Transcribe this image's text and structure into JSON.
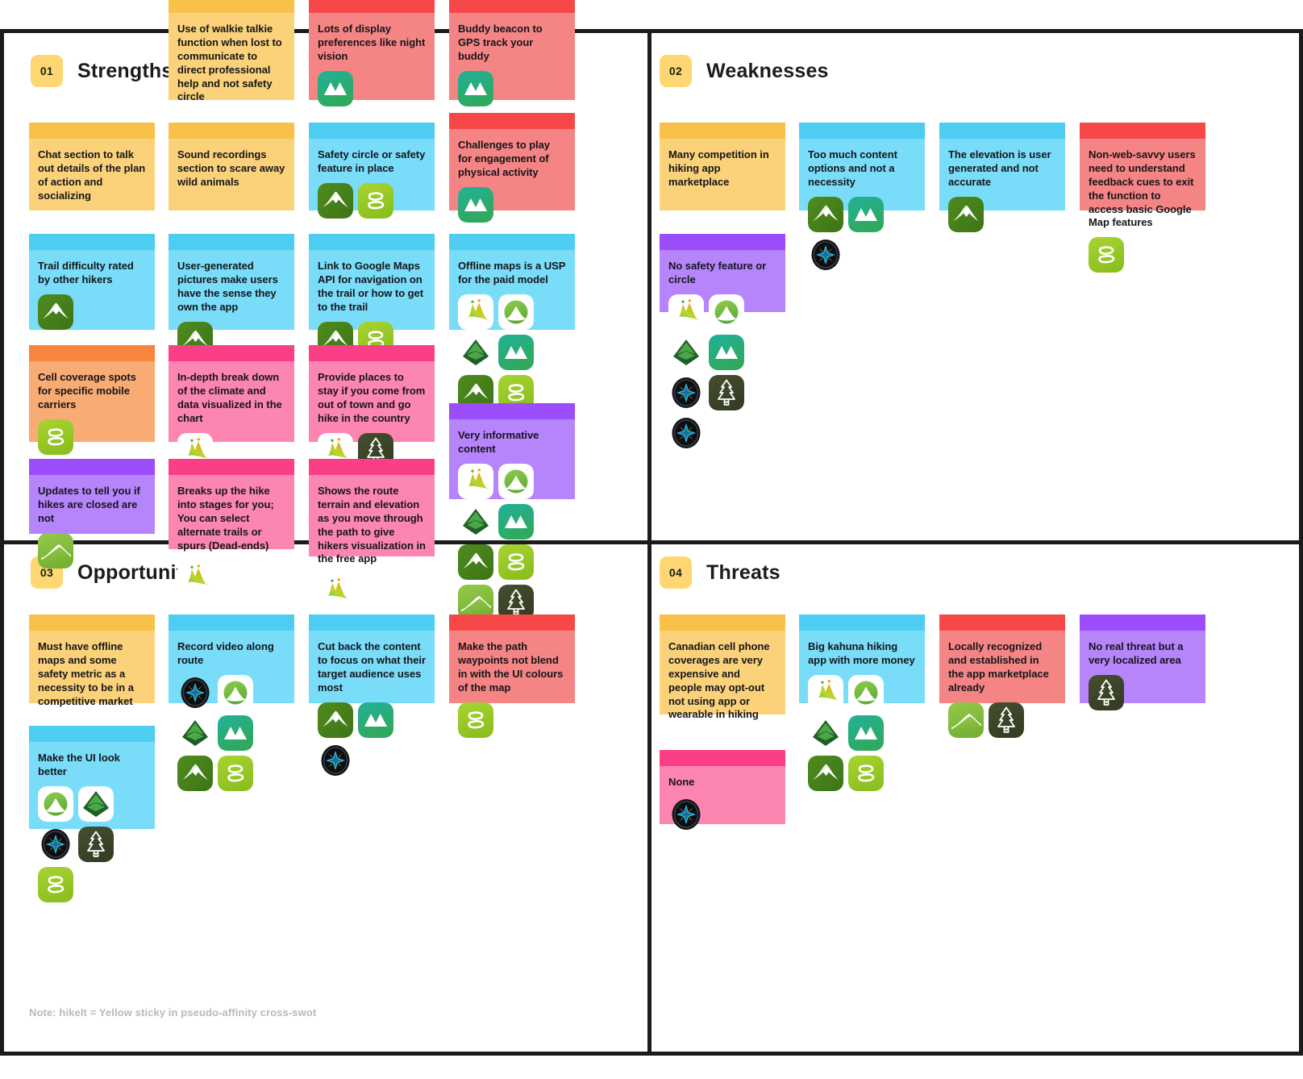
{
  "board": {
    "footer_note": "Note: hikeIt = Yellow sticky in pseudo-affinity cross-swot",
    "accent_badge_color": "#ffd772"
  },
  "quadrants": [
    {
      "num": "01",
      "title": "Strengths"
    },
    {
      "num": "02",
      "title": "Weaknesses"
    },
    {
      "num": "03",
      "title": "Opportunities"
    },
    {
      "num": "04",
      "title": "Threats"
    }
  ],
  "icon_legend": {
    "alltrails": "alltrails-icon",
    "gaia": "gaia-gps-icon",
    "komoot": "komoot-icon",
    "hikingproject": "hiking-project-icon",
    "peakvisor": "peakvisor-icon",
    "outdooractive": "outdooractive-icon",
    "viewranger": "viewranger-compass-icon",
    "pinetree": "pine-tree-icon"
  },
  "notes": {
    "s1": {
      "text": "Use of walkie talkie function when lost to communicate to direct professional help and not safety circle",
      "color": "yellow",
      "icons": []
    },
    "s2": {
      "text": "Lots of display preferences like night vision",
      "color": "red",
      "icons": [
        "komoot"
      ]
    },
    "s3": {
      "text": "Buddy beacon to GPS track your buddy",
      "color": "red",
      "icons": [
        "komoot"
      ]
    },
    "s4": {
      "text": "Chat section to talk out details of the plan of action and socializing",
      "color": "yellow",
      "icons": []
    },
    "s5": {
      "text": "Sound recordings section to scare away wild animals",
      "color": "yellow",
      "icons": []
    },
    "s6": {
      "text": "Safety circle or safety feature in place",
      "color": "blue",
      "icons": [
        "alltrails",
        "outdooractive"
      ]
    },
    "s7": {
      "text": "Challenges to play for engagement of physical activity",
      "color": "red",
      "icons": [
        "komoot"
      ]
    },
    "s8": {
      "text": "Trail difficulty rated by other hikers",
      "color": "blue",
      "icons": [
        "alltrails"
      ]
    },
    "s9": {
      "text": "User-generated pictures make users have the sense they own the app",
      "color": "blue",
      "icons": [
        "alltrails"
      ]
    },
    "s10": {
      "text": "Link to Google Maps API for navigation on the trail or how to get to the trail",
      "color": "blue",
      "icons": [
        "alltrails",
        "outdooractive"
      ]
    },
    "s11": {
      "text": "Offline maps is a USP for the paid model",
      "color": "blue",
      "icons": [
        "peakvisor",
        "gaia",
        "hikingproject",
        "komoot",
        "alltrails",
        "outdooractive",
        "viewranger",
        "pinetree"
      ]
    },
    "s12": {
      "text": "Cell coverage spots for specific mobile carriers",
      "color": "orange",
      "icons": [
        "outdooractive"
      ]
    },
    "s13": {
      "text": "In-depth break down of the climate and data visualized in the chart",
      "color": "pink",
      "icons": [
        "peakvisor"
      ]
    },
    "s14": {
      "text": "Provide places to stay if you come from out of town and go hike in the country",
      "color": "pink",
      "icons": [
        "peakvisor",
        "pinetree"
      ]
    },
    "s15": {
      "text": "Very informative content",
      "color": "purple",
      "icons": [
        "peakvisor",
        "gaia",
        "hikingproject",
        "komoot",
        "alltrails",
        "outdooractive",
        "viewranger",
        "pinetree"
      ]
    },
    "s16": {
      "text": "Updates to tell you if hikes are closed are not",
      "color": "purple",
      "icons": [
        "viewranger"
      ]
    },
    "s17": {
      "text": "Breaks up the hike into stages for you; You can select alternate trails or spurs (Dead-ends)",
      "color": "pink",
      "icons": [
        "peakvisor"
      ]
    },
    "s18": {
      "text": "Shows the route terrain and elevation as you move through the path to give hikers visualization in the free app",
      "color": "pink",
      "icons": [
        "peakvisor"
      ]
    },
    "w1": {
      "text": "Many competition in hiking app marketplace",
      "color": "yellow",
      "icons": []
    },
    "w2": {
      "text": "Too much content options and not a necessity",
      "color": "blue",
      "icons": [
        "alltrails",
        "komoot",
        "viewranger"
      ]
    },
    "w3": {
      "text": "The elevation is user generated and not accurate",
      "color": "blue",
      "icons": [
        "alltrails"
      ]
    },
    "w4": {
      "text": "Non-web-savvy users need to understand feedback cues to exit the function to access basic Google Map features",
      "color": "red",
      "icons": [
        "outdooractive"
      ]
    },
    "w5": {
      "text": "No safety feature or circle",
      "color": "purple",
      "icons": [
        "peakvisor",
        "gaia",
        "hikingproject",
        "komoot",
        "viewranger",
        "pinetree",
        "viewrangercompass"
      ]
    },
    "o1": {
      "text": "Must have offline maps and some safety metric as a necessity to be in a competitive market",
      "color": "yellow",
      "icons": []
    },
    "o2": {
      "text": "Record video along route",
      "color": "blue",
      "icons": [
        "viewranger",
        "gaia",
        "hikingproject",
        "komoot",
        "alltrails",
        "outdooractive"
      ]
    },
    "o3": {
      "text": "Cut back the content to focus on what their target audience uses most",
      "color": "blue",
      "icons": [
        "alltrails",
        "komoot",
        "viewranger"
      ]
    },
    "o4": {
      "text": "Make the path waypoints not blend in with the UI colours of the map",
      "color": "red",
      "icons": [
        "outdooractive"
      ]
    },
    "o5": {
      "text": "Make the UI look better",
      "color": "blue",
      "icons": [
        "gaia",
        "hikingproject",
        "viewranger",
        "pinetree",
        "outdooractive"
      ]
    },
    "t1": {
      "text": "Canadian cell phone coverages are very expensive and people may opt-out not using app or wearable in hiking",
      "color": "yellow",
      "icons": []
    },
    "t2": {
      "text": "Big kahuna hiking app with more money",
      "color": "blue",
      "icons": [
        "peakvisor",
        "gaia",
        "hikingproject",
        "komoot",
        "alltrails",
        "outdooractive"
      ]
    },
    "t3": {
      "text": "Locally recognized and established in the app marketplace already",
      "color": "red",
      "icons": [
        "viewranger",
        "pinetree"
      ]
    },
    "t4": {
      "text": "No real threat but a very localized area",
      "color": "purple",
      "icons": [
        "pinetree"
      ]
    },
    "t5": {
      "text": "None",
      "color": "pink",
      "icons": [
        "viewranger"
      ]
    }
  }
}
